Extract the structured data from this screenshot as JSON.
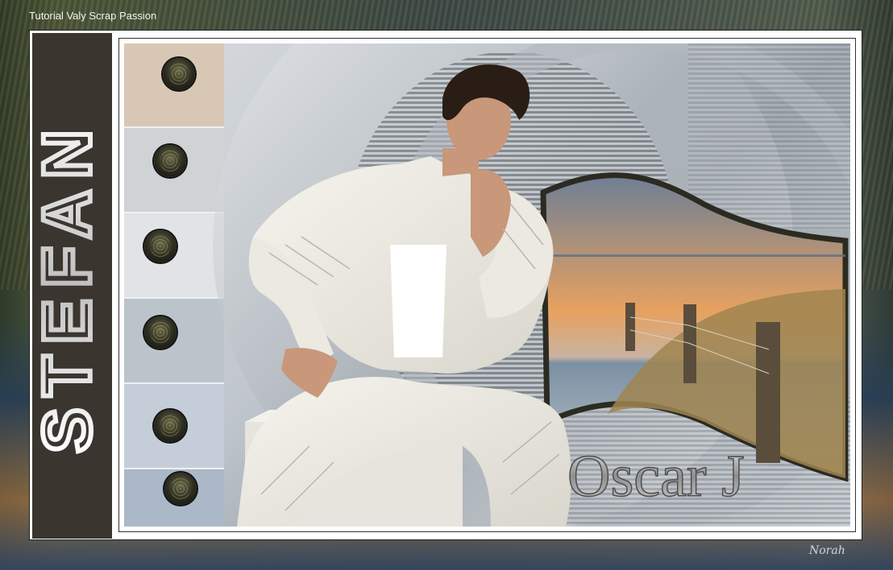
{
  "page": {
    "caption": "Tutorial Valy Scrap Passion",
    "signature": "Norah",
    "title_art": "Oscar J",
    "band_text": "STEFAN"
  },
  "colors": {
    "band": "#3a352e",
    "frame": "#ffffff",
    "sunset": "#e7a15f",
    "sea": "#8ea2b4"
  },
  "icons": [
    "bead-icon",
    "bead-icon",
    "bead-icon",
    "bead-icon",
    "bead-icon",
    "bead-icon"
  ]
}
